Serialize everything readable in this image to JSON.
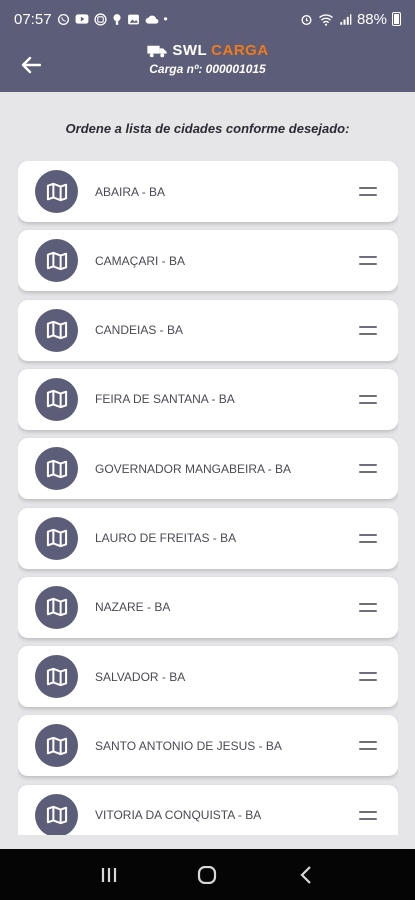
{
  "status_bar": {
    "time": "07:57",
    "battery": "88%",
    "left_icons": [
      "whatsapp-icon",
      "youtube-icon",
      "instagram-icon",
      "notification-icon",
      "gallery-icon",
      "cloud-icon",
      "dot-icon"
    ],
    "right_icons": [
      "alarm-icon",
      "wifi-icon",
      "signal-icon",
      "battery-icon"
    ]
  },
  "header": {
    "brand_swl": "SWL",
    "brand_carga": "CARGA",
    "cargo_label": "Carga nº: 000001015",
    "background": "#5c5d78",
    "brand_accent": "#f07a1a"
  },
  "instruction": "Ordene a lista de cidades conforme desejado:",
  "cities": [
    "ABAIRA - BA",
    "CAMAÇARI - BA",
    "CANDEIAS - BA",
    "FEIRA DE SANTANA - BA",
    "GOVERNADOR MANGABEIRA - BA",
    "LAURO DE FREITAS - BA",
    "NAZARE - BA",
    "SALVADOR - BA",
    "SANTO ANTONIO DE JESUS - BA",
    "VITORIA DA CONQUISTA - BA"
  ],
  "nav_bar": {
    "buttons": [
      "recents-icon",
      "home-icon",
      "back-nav-icon"
    ]
  }
}
